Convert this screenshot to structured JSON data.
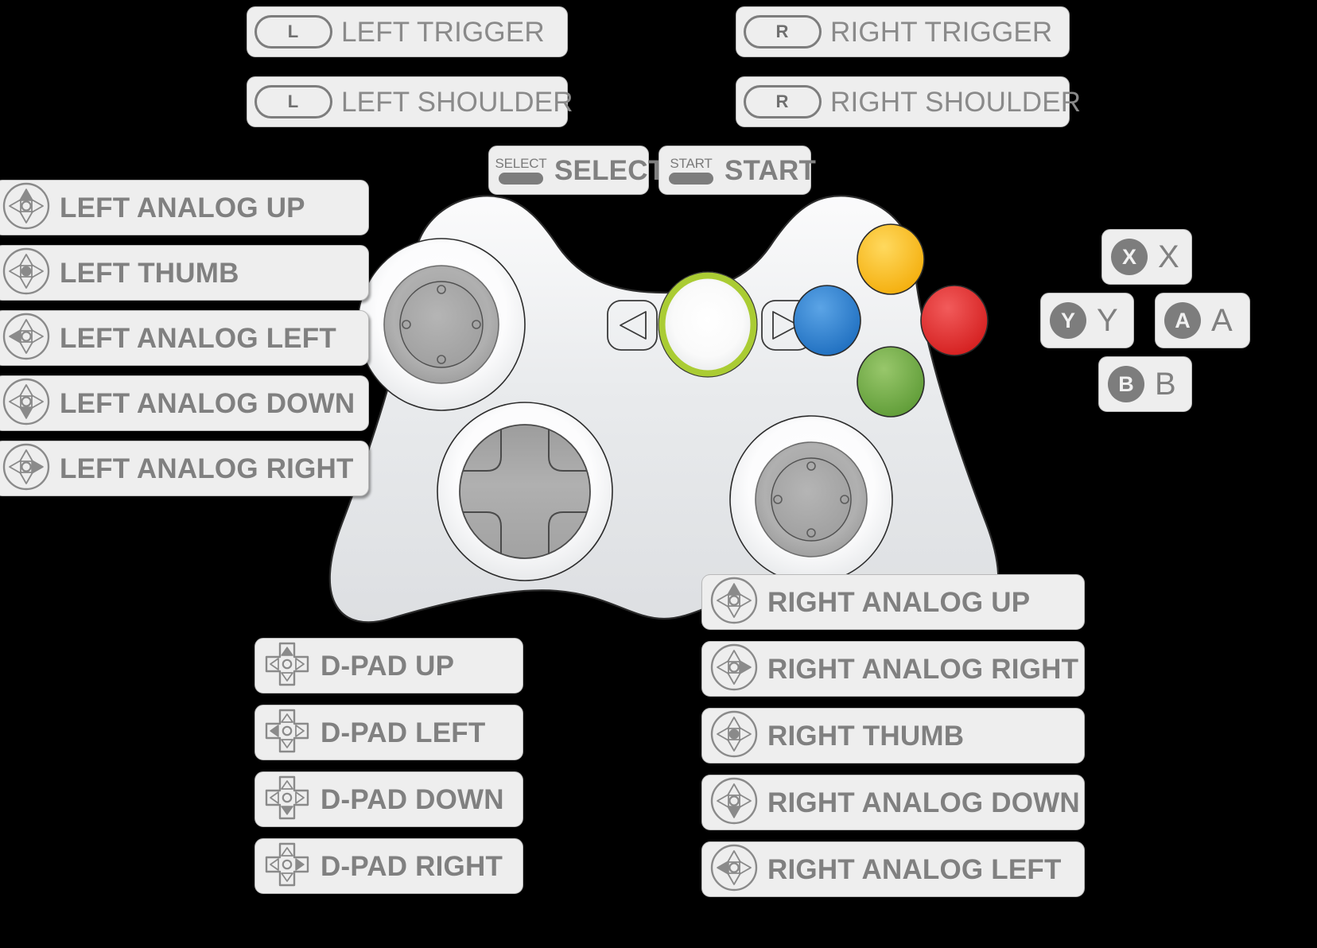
{
  "colors": {
    "chip_bg": "#eeeeee",
    "chip_border": "#b9b9b9",
    "label_text": "#808080",
    "icon_gray": "#7d7d7d",
    "body_light": "#f2f2f2",
    "body_shade": "#e2e4e6",
    "guide_ring": "#aacc33",
    "btn_y": "#fbc02d",
    "btn_b": "#3081d0",
    "btn_r": "#e02b2b",
    "btn_a": "#74ad46",
    "dpad_gray": "#a8a8a8",
    "stick_gray": "#a9a9a9",
    "background": "#000000"
  },
  "triggers": [
    {
      "icon": "l-shoulder-pill-icon",
      "badge": "L",
      "label": "LEFT TRIGGER"
    },
    {
      "icon": "l-shoulder-pill-icon",
      "badge": "L",
      "label": "LEFT SHOULDER"
    },
    {
      "icon": "r-shoulder-pill-icon",
      "badge": "R",
      "label": "RIGHT TRIGGER"
    },
    {
      "icon": "r-shoulder-pill-icon",
      "badge": "R",
      "label": "RIGHT SHOULDER"
    }
  ],
  "system": [
    {
      "icon": "select-button-icon",
      "icon_caption": "SELECT",
      "label": "SELECT"
    },
    {
      "icon": "start-button-icon",
      "icon_caption": "START",
      "label": "START"
    }
  ],
  "left_analog": [
    {
      "icon": "analog-stick-up-icon",
      "dir": "up",
      "label": "LEFT ANALOG UP"
    },
    {
      "icon": "analog-stick-press-icon",
      "dir": "press",
      "label": "LEFT THUMB"
    },
    {
      "icon": "analog-stick-left-icon",
      "dir": "left",
      "label": "LEFT ANALOG LEFT"
    },
    {
      "icon": "analog-stick-down-icon",
      "dir": "down",
      "label": "LEFT ANALOG DOWN"
    },
    {
      "icon": "analog-stick-right-icon",
      "dir": "right",
      "label": "LEFT ANALOG RIGHT"
    }
  ],
  "dpad": [
    {
      "icon": "dpad-up-icon",
      "dir": "up",
      "label": "D-PAD UP"
    },
    {
      "icon": "dpad-left-icon",
      "dir": "left",
      "label": "D-PAD LEFT"
    },
    {
      "icon": "dpad-down-icon",
      "dir": "down",
      "label": "D-PAD DOWN"
    },
    {
      "icon": "dpad-right-icon",
      "dir": "right",
      "label": "D-PAD RIGHT"
    }
  ],
  "right_analog": [
    {
      "icon": "analog-stick-up-icon",
      "dir": "up",
      "label": "RIGHT ANALOG UP"
    },
    {
      "icon": "analog-stick-right-icon",
      "dir": "right",
      "label": "RIGHT ANALOG RIGHT"
    },
    {
      "icon": "analog-stick-press-icon",
      "dir": "press",
      "label": "RIGHT THUMB"
    },
    {
      "icon": "analog-stick-down-icon",
      "dir": "down",
      "label": "RIGHT ANALOG DOWN"
    },
    {
      "icon": "analog-stick-left-icon",
      "dir": "left",
      "label": "RIGHT ANALOG LEFT"
    }
  ],
  "face_buttons": [
    {
      "icon": "x-button-icon",
      "badge": "X",
      "label": "X"
    },
    {
      "icon": "y-button-icon",
      "badge": "Y",
      "label": "Y"
    },
    {
      "icon": "a-button-icon",
      "badge": "A",
      "label": "A"
    },
    {
      "icon": "b-button-icon",
      "badge": "B",
      "label": "B"
    }
  ]
}
